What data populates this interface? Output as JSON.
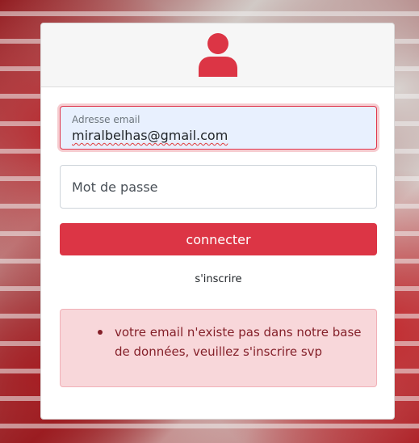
{
  "login_form": {
    "email_label": "Adresse email",
    "email_value": "miralbelhas@gmail.com",
    "password_placeholder": "Mot de passe",
    "submit_label": "connecter",
    "signup_link": "s'inscrire"
  },
  "error_alert": {
    "items": [
      "votre email n'existe pas dans notre base de données, veuillez s'inscrire svp"
    ]
  },
  "colors": {
    "accent": "#dc3545",
    "alert_background": "#f8d7da",
    "alert_text": "#842029"
  },
  "icons": {
    "header_icon": "user-icon"
  }
}
